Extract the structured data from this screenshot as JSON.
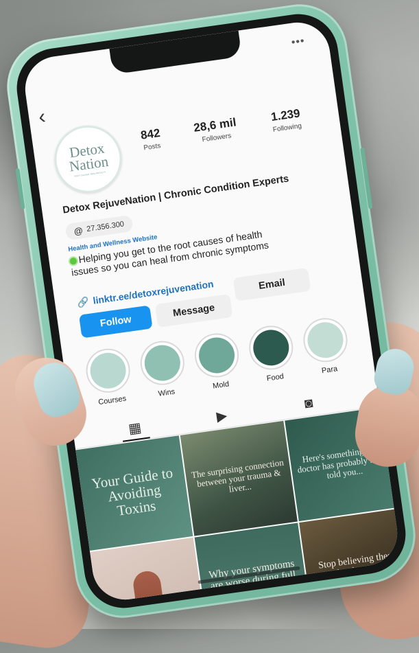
{
  "profile": {
    "avatar_line1": "Detox",
    "avatar_line2": "Nation",
    "avatar_tagline": "ROOT CAUSES. REAL RESULTS.",
    "posts_count": "842",
    "posts_label": "Posts",
    "followers_count": "28,6 mil",
    "followers_label": "Followers",
    "following_count": "1.239",
    "following_label": "Following",
    "name": "Detox RejuveNation | Chronic Condition Experts",
    "threads_handle": "27.356.300",
    "category": "Health and Wellness Website",
    "bio": "Helping you get to the root causes of health issues so you can heal from chronic symptoms",
    "link": "linktr.ee/detoxrejuvenation"
  },
  "actions": {
    "follow": "Follow",
    "message": "Message",
    "email": "Email"
  },
  "highlights": [
    {
      "label": "Courses",
      "color": "#b9d8cf"
    },
    {
      "label": "Wins",
      "color": "#8fc0b2"
    },
    {
      "label": "Mold",
      "color": "#6fa898"
    },
    {
      "label": "Food",
      "color": "#2d5a4f"
    },
    {
      "label": "Para",
      "color": "#c3ddd5"
    }
  ],
  "posts": [
    "Your Guide to Avoiding Toxins",
    "The surprising connection between your trauma & liver...",
    "Here's something your doctor has probably never told you...",
    "",
    "Why your symptoms are worse during full moon...",
    "Stop believing these myths about mold."
  ],
  "icons": {
    "back": "chevron-left-icon",
    "more": "more-dots-icon",
    "threads": "threads-icon",
    "link": "link-icon",
    "grid": "grid-icon",
    "reels": "reels-icon",
    "tagged": "tagged-icon"
  },
  "colors": {
    "phone_case": "#7fc2aa",
    "follow_button": "#1993f0",
    "link": "#1f73c4"
  }
}
